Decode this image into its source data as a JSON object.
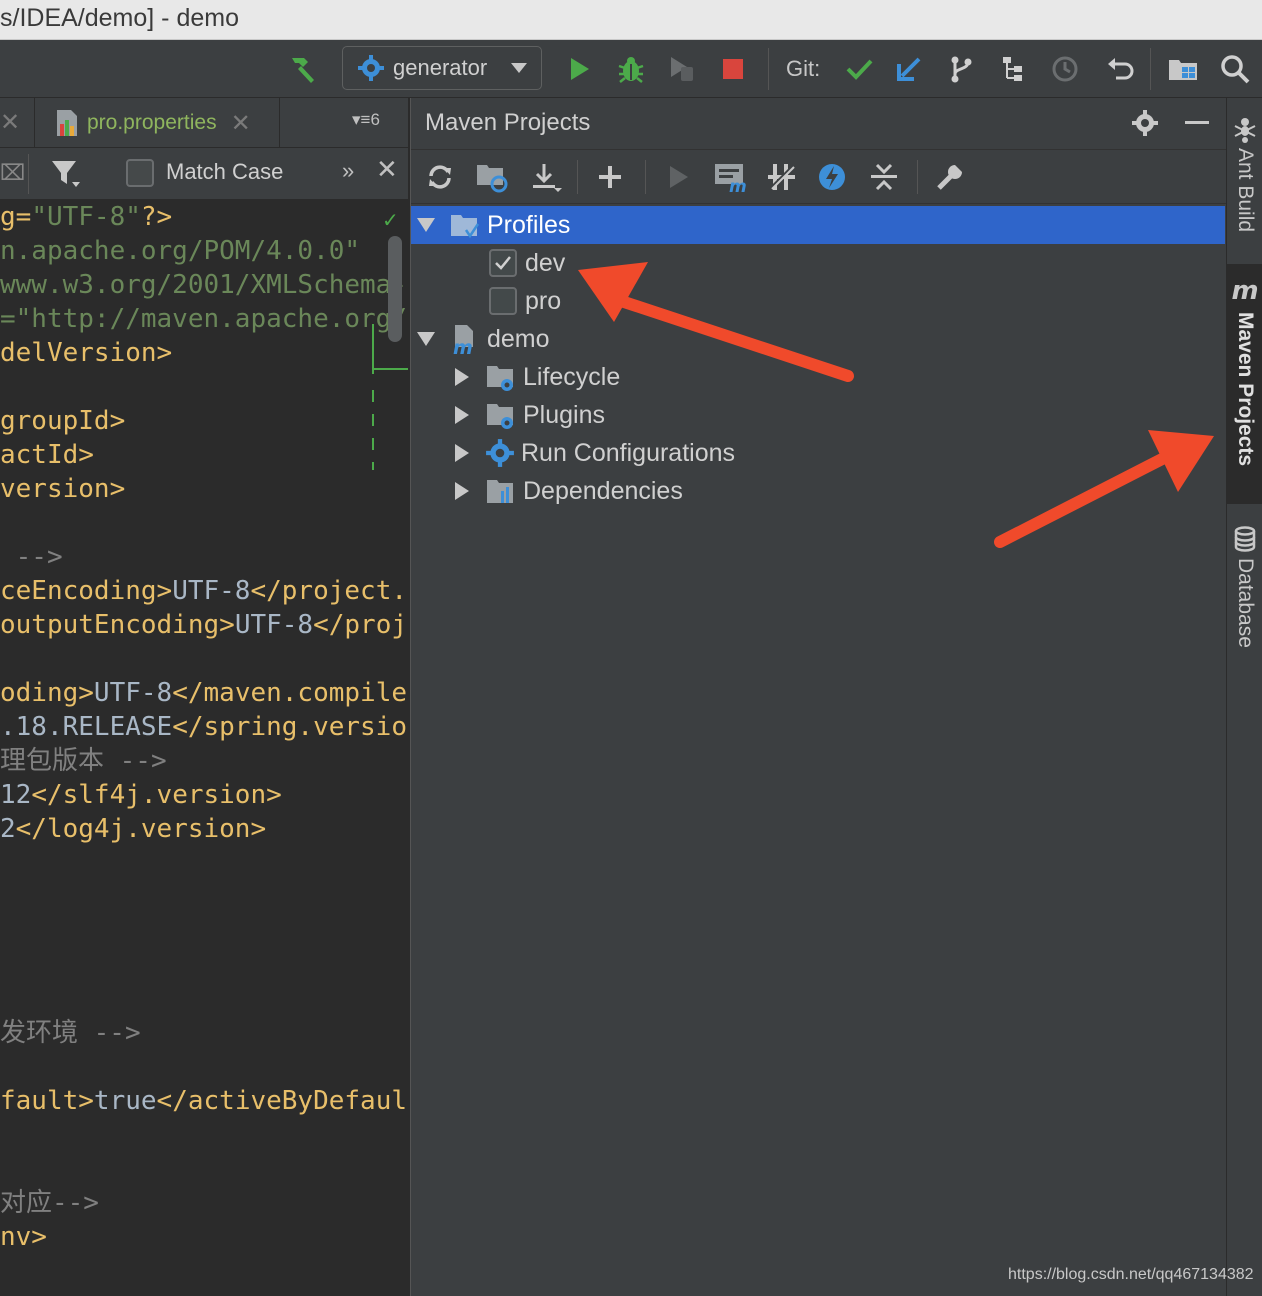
{
  "window": {
    "title": "s/IDEA/demo] - demo"
  },
  "toolbar": {
    "run_config": "generator",
    "git_label": "Git:",
    "icons": [
      "hammer-icon",
      "gear-icon",
      "run-icon",
      "debug-icon",
      "coverage-icon",
      "stop-icon",
      "git-update-icon",
      "git-commit-icon",
      "branch-icon",
      "structure-icon",
      "history-icon",
      "revert-icon",
      "project-structure-icon",
      "search-icon"
    ]
  },
  "editor": {
    "tab_label": "pro.properties",
    "tab_count": "6",
    "search": {
      "match_case_label": "Match Case",
      "more": "»",
      "close": "✕"
    },
    "code_lines": [
      {
        "parts": [
          {
            "t": "g=",
            "c": "tag"
          },
          {
            "t": "\"UTF-8\"",
            "c": "str"
          },
          {
            "t": "?>",
            "c": "tag"
          }
        ]
      },
      {
        "parts": [
          {
            "t": "n.apache.org/POM/4.0.0\"",
            "c": "str"
          }
        ]
      },
      {
        "parts": [
          {
            "t": "www.w3.org/2001/XMLSchema-",
            "c": "str"
          }
        ]
      },
      {
        "parts": [
          {
            "t": "=\"http://maven.apache.org/",
            "c": "str"
          }
        ]
      },
      {
        "parts": [
          {
            "t": "delVersion>",
            "c": "tag"
          }
        ]
      },
      {
        "parts": []
      },
      {
        "parts": [
          {
            "t": "groupId>",
            "c": "tag"
          }
        ]
      },
      {
        "parts": [
          {
            "t": "actId>",
            "c": "tag"
          }
        ]
      },
      {
        "parts": [
          {
            "t": "version>",
            "c": "tag"
          }
        ]
      },
      {
        "parts": []
      },
      {
        "parts": [
          {
            "t": " -->",
            "c": "cmt"
          }
        ]
      },
      {
        "parts": [
          {
            "t": "ceEncoding>",
            "c": "tag"
          },
          {
            "t": "UTF-8",
            "c": "val"
          },
          {
            "t": "</project.",
            "c": "tag"
          }
        ]
      },
      {
        "parts": [
          {
            "t": "outputEncoding>",
            "c": "tag"
          },
          {
            "t": "UTF-8",
            "c": "val"
          },
          {
            "t": "</proj",
            "c": "tag"
          }
        ]
      },
      {
        "parts": []
      },
      {
        "parts": [
          {
            "t": "oding>",
            "c": "tag"
          },
          {
            "t": "UTF-8",
            "c": "val"
          },
          {
            "t": "</maven.compile",
            "c": "tag"
          }
        ]
      },
      {
        "parts": [
          {
            "t": ".18.RELEASE",
            "c": "val"
          },
          {
            "t": "</spring.versio",
            "c": "tag"
          }
        ]
      },
      {
        "parts": [
          {
            "t": "理包版本 -->",
            "c": "cmt"
          }
        ]
      },
      {
        "parts": [
          {
            "t": "12",
            "c": "val"
          },
          {
            "t": "</slf4j.version>",
            "c": "tag"
          }
        ]
      },
      {
        "parts": [
          {
            "t": "2",
            "c": "val"
          },
          {
            "t": "</log4j.version>",
            "c": "tag"
          }
        ]
      },
      {
        "parts": []
      },
      {
        "parts": []
      },
      {
        "parts": []
      },
      {
        "parts": []
      },
      {
        "parts": []
      },
      {
        "parts": [
          {
            "t": "发环境 -->",
            "c": "cmt"
          }
        ]
      },
      {
        "parts": []
      },
      {
        "parts": [
          {
            "t": "fault>",
            "c": "tag"
          },
          {
            "t": "true",
            "c": "val"
          },
          {
            "t": "</activeByDefaul",
            "c": "tag"
          }
        ]
      },
      {
        "parts": []
      },
      {
        "parts": []
      },
      {
        "parts": [
          {
            "t": "对应-->",
            "c": "cmt"
          }
        ]
      },
      {
        "parts": [
          {
            "t": "nv>",
            "c": "tag"
          }
        ]
      }
    ]
  },
  "maven": {
    "title": "Maven Projects",
    "tools": [
      "reimport-icon",
      "generate-sources-icon",
      "download-icon",
      "add-icon",
      "run-goal-icon",
      "execute-goal-icon",
      "toggle-offline-icon",
      "skip-tests-icon",
      "collapse-all-icon",
      "settings-wrench-icon"
    ],
    "tree": {
      "profiles_label": "Profiles",
      "profiles": [
        {
          "name": "dev",
          "checked": true
        },
        {
          "name": "pro",
          "checked": false
        }
      ],
      "project_label": "demo",
      "children": [
        "Lifecycle",
        "Plugins",
        "Run Configurations",
        "Dependencies"
      ]
    }
  },
  "right_stripe": {
    "ant_build": "Ant Build",
    "maven_projects": "Maven Projects",
    "maven_letter": "m",
    "database": "Database"
  },
  "colors": {
    "selection": "#2f65ca",
    "annotation_arrow": "#f04a2b",
    "xml_tag": "#e8bf6a",
    "xml_string": "#6a8759",
    "comment": "#808080",
    "link_green": "#8fb55e"
  },
  "watermark": "https://blog.csdn.net/qq467134382"
}
